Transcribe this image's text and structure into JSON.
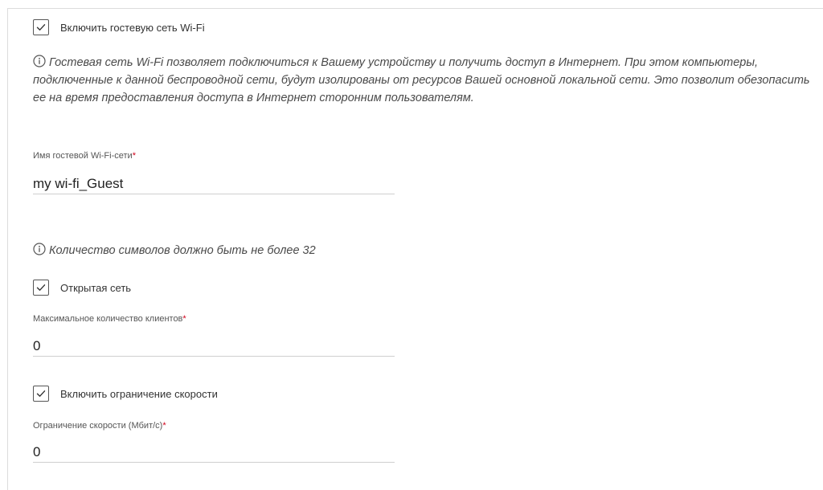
{
  "guest_wifi": {
    "enable_label": "Включить гостевую сеть Wi-Fi",
    "enable_checked": true,
    "description": "Гостевая сеть Wi-Fi позволяет подключиться к Вашему устройству и получить доступ в Интернет. При этом компьютеры, подключенные к данной беспроводной сети, будут изолированы от ресурсов Вашей основной локальной сети. Это позволит обезопасить ее на время предоставления доступа в Интернет сторонним пользователям."
  },
  "ssid": {
    "label": "Имя гостевой Wi-Fi-сети",
    "required_mark": "*",
    "value": "my wi-fi_Guest",
    "hint": "Количество символов должно быть не более 32"
  },
  "open_network": {
    "label": "Открытая сеть",
    "checked": true
  },
  "max_clients": {
    "label": "Максимальное количество клиентов",
    "required_mark": "*",
    "value": "0"
  },
  "speed_limit": {
    "enable_label": "Включить ограничение скорости",
    "enable_checked": true,
    "label": "Ограничение скорости (Мбит/с)",
    "required_mark": "*",
    "value": "0"
  },
  "colors": {
    "required": "#d0021b",
    "checkbox_border": "#555555",
    "underline": "#cfcfcf"
  },
  "icons": {
    "check": "checkmark-icon",
    "info": "info-circle-icon"
  }
}
